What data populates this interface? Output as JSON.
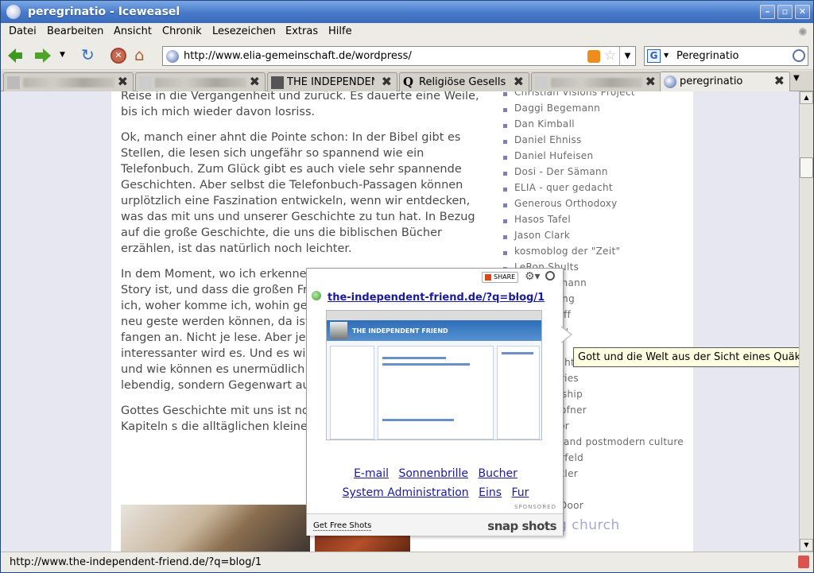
{
  "window": {
    "title": "peregrinatio - Iceweasel"
  },
  "menubar": [
    "Datei",
    "Bearbeiten",
    "Ansicht",
    "Chronik",
    "Lesezeichen",
    "Extras",
    "Hilfe"
  ],
  "navigation": {
    "url": "http://www.elia-gemeinschaft.de/wordpress/",
    "search_engine": "G",
    "search_value": "Peregrinatio"
  },
  "tabs": [
    {
      "label": "",
      "blurred": true
    },
    {
      "label": "",
      "blurred": true
    },
    {
      "label": "THE INDEPENDENT F…",
      "blurred": false
    },
    {
      "label": "Religiöse Gesellschaft…",
      "blurred": false
    },
    {
      "label": "",
      "blurred": true
    },
    {
      "label": "peregrinatio",
      "blurred": false,
      "active": true
    }
  ],
  "article": {
    "paragraphs": [
      "Reise in die Vergangenheit und zurück. Es dauerte eine Weile, bis ich mich wieder davon losriss.",
      "Ok, manch einer ahnt die Pointe schon: In der Bibel gibt es Stellen, die lesen sich ungefähr so spannend wie ein Telefonbuch. Zum Glück gibt es auch viele sehr spannende Geschichten. Aber selbst die Telefonbuch-Passagen können urplötzlich eine Faszination entwickeln, wenn wir entdecken, was das mit uns und unserer Geschichte zu tun hat. In Bezug auf die große Geschichte, die uns die biblischen Bücher erzählen, ist das natürlich noch leichter.",
      "In dem Moment, wo ich erkenne, dass diese ganze Story meine Story ist, und dass die großen Fragen meines Lebens (wer bin ich, woher komme ich, wohin gehe ich) Licht dieser Geschichte neu geste werden können, da ist Schluss mit Aha-Erlebnisse fangen an. Nicht je lese. Aber je mehr alte Freunde m interessanter wird es. Und es wird diese Geschichten wieder und wie können es unermüdlich tun und je Vergangenheit lebendig, sondern Gegenwart aus.",
      "Gottes Geschichte mit uns ist noc Blättern in den früheren Kapiteln s die alltäglichen kleinen Schritte in"
    ]
  },
  "sidebar": {
    "links": [
      "Christian Visions Project",
      "Daggi Begemann",
      "Dan Kimball",
      "Daniel Ehniss",
      "Daniel Hufeisen",
      "Dosi - Der Sämann",
      "ELIA - quer gedacht",
      "Generous Orthodoxy",
      "Hasos Tafel",
      "Jason Clark",
      "kosmoblog der \"Zeit\"",
      "LeRon Shults",
      "mann",
      "ing",
      "off",
      "dy",
      "",
      "ght",
      "Vries",
      "ership",
      "öpfner",
      "or",
      "and postmodern culture",
      "örfeld",
      "kler",
      "",
      "Door"
    ],
    "section": "emerging church"
  },
  "popup": {
    "share_label": "SHARE",
    "url": "the-independent-friend.de/?q=blog/1",
    "thumb_title": "THE INDEPENDENT FRIEND",
    "ad_links": [
      "E-mail",
      "Sonnenbrille",
      "Bucher",
      "System Administration",
      "Eins",
      "Fur"
    ],
    "sponsored": "SPONSORED",
    "get_free": "Get Free Shots",
    "brand": "snap shots"
  },
  "tooltip": "Gott und die Welt aus der Sicht eines Quäkers",
  "status": "http://www.the-independent-friend.de/?q=blog/1",
  "colors": {
    "title_bar": "#4779c8",
    "link": "#1a1a9c",
    "sidebar_text": "#6a6a6a",
    "section_heading": "#a7a7d6"
  }
}
